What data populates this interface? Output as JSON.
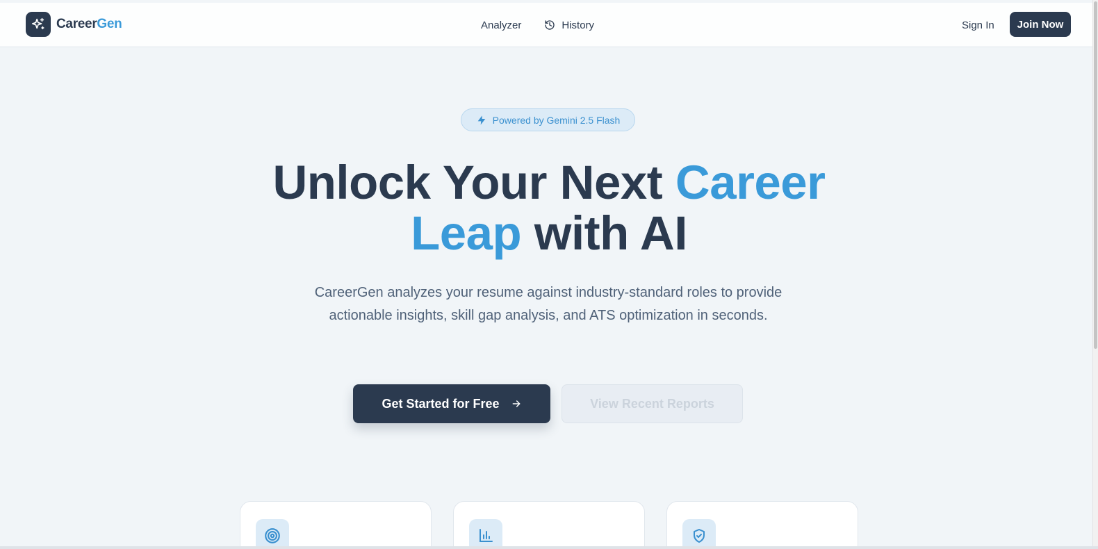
{
  "brand": {
    "name_part1": "Career",
    "name_part2": "Gen",
    "logo_icon": "sparkles-icon"
  },
  "nav": {
    "links": [
      {
        "label": "Analyzer"
      },
      {
        "label": "History",
        "icon": "history-icon"
      }
    ],
    "sign_in": "Sign In",
    "join_now": "Join Now"
  },
  "hero": {
    "badge": "Powered by Gemini 2.5 Flash",
    "badge_icon": "lightning-icon",
    "title_line1_a": "Unlock Your Next ",
    "title_line1_b": "Career",
    "title_line2_a": "Leap",
    "title_line2_b": " with AI",
    "subtitle": "CareerGen analyzes your resume against industry-standard roles to provide actionable insights, skill gap analysis, and ATS optimization in seconds.",
    "primary_button": "Get Started for Free",
    "secondary_button": "View Recent Reports"
  },
  "feature_cards": [
    {
      "icon": "target-icon"
    },
    {
      "icon": "bar-chart-icon"
    },
    {
      "icon": "shield-check-icon"
    }
  ],
  "colors": {
    "primary": "#2b3a4f",
    "accent": "#3a9ad9",
    "background": "#f1f5f8",
    "badge_bg": "#dcebf7"
  }
}
